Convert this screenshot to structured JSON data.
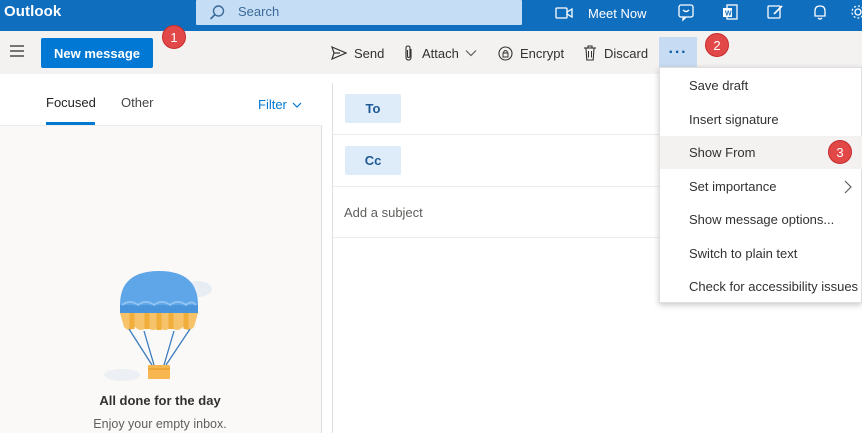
{
  "app": {
    "title": "Outlook"
  },
  "search": {
    "placeholder": "Search"
  },
  "topbar": {
    "meet_now_label": "Meet Now",
    "icons": [
      "video-icon",
      "skype-icon",
      "word-icon",
      "feedback-icon",
      "bell-icon",
      "gear-icon"
    ]
  },
  "toolbar": {
    "new_message_label": "New message",
    "send_label": "Send",
    "attach_label": "Attach",
    "encrypt_label": "Encrypt",
    "discard_label": "Discard",
    "more_label": "···"
  },
  "callouts": {
    "one": "1",
    "two": "2",
    "three": "3"
  },
  "mail_list": {
    "tabs": [
      {
        "label": "Focused"
      },
      {
        "label": "Other"
      }
    ],
    "filter_label": "Filter",
    "empty_title": "All done for the day",
    "empty_subtitle": "Enjoy your empty inbox."
  },
  "compose": {
    "to_label": "To",
    "cc_label": "Cc",
    "subject_placeholder": "Add a subject"
  },
  "more_menu": {
    "items": [
      {
        "label": "Save draft"
      },
      {
        "label": "Insert signature"
      },
      {
        "label": "Show From"
      },
      {
        "label": "Set importance"
      },
      {
        "label": "Show message options..."
      },
      {
        "label": "Switch to plain text"
      },
      {
        "label": "Check for accessibility issues"
      }
    ]
  },
  "colors": {
    "brand_blue": "#0078d4",
    "callout_red": "#e34848",
    "menu_highlight": "#f3f2f1"
  }
}
